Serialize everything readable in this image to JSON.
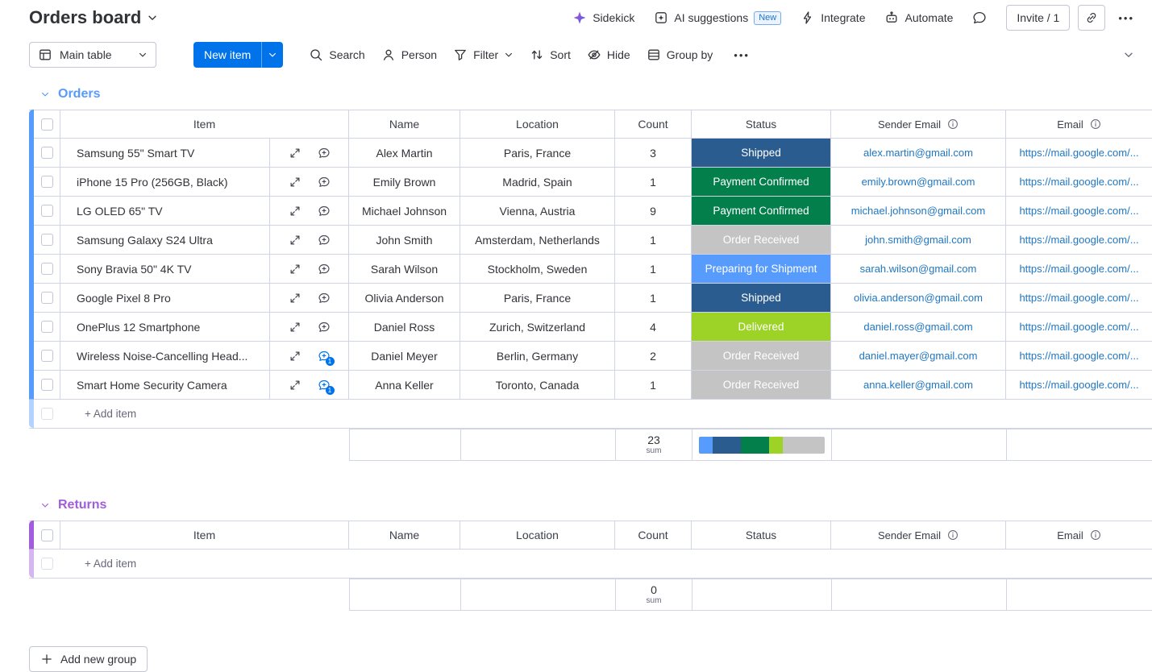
{
  "icons": {
    "dots": "•••"
  },
  "header": {
    "title": "Orders board",
    "sidekick": "Sidekick",
    "ai_suggestions": "AI suggestions",
    "new_badge": "New",
    "integrate": "Integrate",
    "automate": "Automate",
    "invite": "Invite / 1"
  },
  "toolbar": {
    "view": "Main table",
    "new_item": "New item",
    "search": "Search",
    "person": "Person",
    "filter": "Filter",
    "sort": "Sort",
    "hide": "Hide",
    "group_by": "Group by"
  },
  "columns": {
    "item": "Item",
    "name": "Name",
    "location": "Location",
    "count": "Count",
    "status": "Status",
    "sender_email": "Sender Email",
    "email": "Email"
  },
  "groups": [
    {
      "name": "Orders",
      "color": "#579bfc",
      "add_item": "+ Add item",
      "summary": {
        "count_sum": "23",
        "sum_label": "sum",
        "segments": [
          {
            "status": "Preparing for Shipment",
            "color": "#579bfc",
            "width": "11.1%"
          },
          {
            "status": "Shipped",
            "color": "#2b5c8f",
            "width": "22.2%"
          },
          {
            "status": "Payment Confirmed",
            "color": "#037f4c",
            "width": "22.2%"
          },
          {
            "status": "Delivered",
            "color": "#9cd326",
            "width": "11.1%"
          },
          {
            "status": "Order Received",
            "color": "#c4c4c4",
            "width": "33.4%"
          }
        ]
      },
      "rows": [
        {
          "item": "Samsung 55\" Smart TV",
          "name": "Alex Martin",
          "location": "Paris, France",
          "count": "3",
          "status": "Shipped",
          "status_color": "#2b5c8f",
          "sender_email": "alex.martin@gmail.com",
          "email_link": "https://mail.google.com/..."
        },
        {
          "item": "iPhone 15 Pro (256GB, Black)",
          "name": "Emily Brown",
          "location": "Madrid, Spain",
          "count": "1",
          "status": "Payment Confirmed",
          "status_color": "#037f4c",
          "sender_email": "emily.brown@gmail.com",
          "email_link": "https://mail.google.com/..."
        },
        {
          "item": "LG OLED 65\" TV",
          "name": "Michael Johnson",
          "location": "Vienna, Austria",
          "count": "9",
          "status": "Payment Confirmed",
          "status_color": "#037f4c",
          "sender_email": "michael.johnson@gmail.com",
          "email_link": "https://mail.google.com/..."
        },
        {
          "item": "Samsung Galaxy S24 Ultra",
          "name": "John Smith",
          "location": "Amsterdam, Netherlands",
          "count": "1",
          "status": "Order Received",
          "status_color": "#c4c4c4",
          "sender_email": "john.smith@gmail.com",
          "email_link": "https://mail.google.com/..."
        },
        {
          "item": "Sony Bravia 50\" 4K TV",
          "name": "Sarah Wilson",
          "location": "Stockholm, Sweden",
          "count": "1",
          "status": "Preparing for Shipment",
          "status_color": "#579bfc",
          "sender_email": "sarah.wilson@gmail.com",
          "email_link": "https://mail.google.com/..."
        },
        {
          "item": "Google Pixel 8 Pro",
          "name": "Olivia Anderson",
          "location": "Paris, France",
          "count": "1",
          "status": "Shipped",
          "status_color": "#2b5c8f",
          "sender_email": "olivia.anderson@gmail.com",
          "email_link": "https://mail.google.com/..."
        },
        {
          "item": "OnePlus 12 Smartphone",
          "name": "Daniel Ross",
          "location": "Zurich, Switzerland",
          "count": "4",
          "status": "Delivered",
          "status_color": "#9cd326",
          "sender_email": "daniel.ross@gmail.com",
          "email_link": "https://mail.google.com/..."
        },
        {
          "item": "Wireless Noise-Cancelling Head...",
          "name": "Daniel Meyer",
          "location": "Berlin, Germany",
          "count": "2",
          "status": "Order Received",
          "status_color": "#c4c4c4",
          "sender_email": "daniel.mayer@gmail.com",
          "email_link": "https://mail.google.com/...",
          "updates": "1"
        },
        {
          "item": "Smart Home Security Camera",
          "name": "Anna Keller",
          "location": "Toronto, Canada",
          "count": "1",
          "status": "Order Received",
          "status_color": "#c4c4c4",
          "sender_email": "anna.keller@gmail.com",
          "email_link": "https://mail.google.com/...",
          "updates": "1"
        }
      ]
    },
    {
      "name": "Returns",
      "color": "#a25ddc",
      "add_item": "+ Add item",
      "summary": {
        "count_sum": "0",
        "sum_label": "sum",
        "segments": []
      }
    }
  ],
  "footer": {
    "add_new_group": "Add new group"
  }
}
